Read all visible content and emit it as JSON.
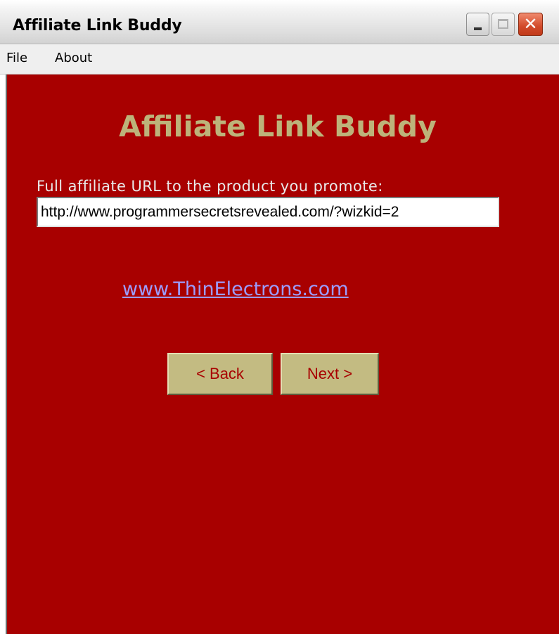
{
  "window": {
    "title": "Affiliate Link Buddy",
    "close_glyph": "✕"
  },
  "menu": {
    "file": "File",
    "about": "About"
  },
  "main": {
    "heading": "Affiliate Link Buddy",
    "url_label": "Full affiliate URL to the product you promote:",
    "url_value": "http://www.programmersecretsrevealed.com/?wizkid=2",
    "site_link": "www.ThinElectrons.com",
    "back_button": "< Back",
    "next_button": "Next >"
  },
  "colors": {
    "panel_background": "#a80000",
    "heading_color": "#bdb37a",
    "button_background": "#c3bb82",
    "link_color": "#9c9cff"
  },
  "icons": {
    "minimize": "minimize-icon",
    "maximize": "maximize-icon",
    "close": "close-icon"
  }
}
